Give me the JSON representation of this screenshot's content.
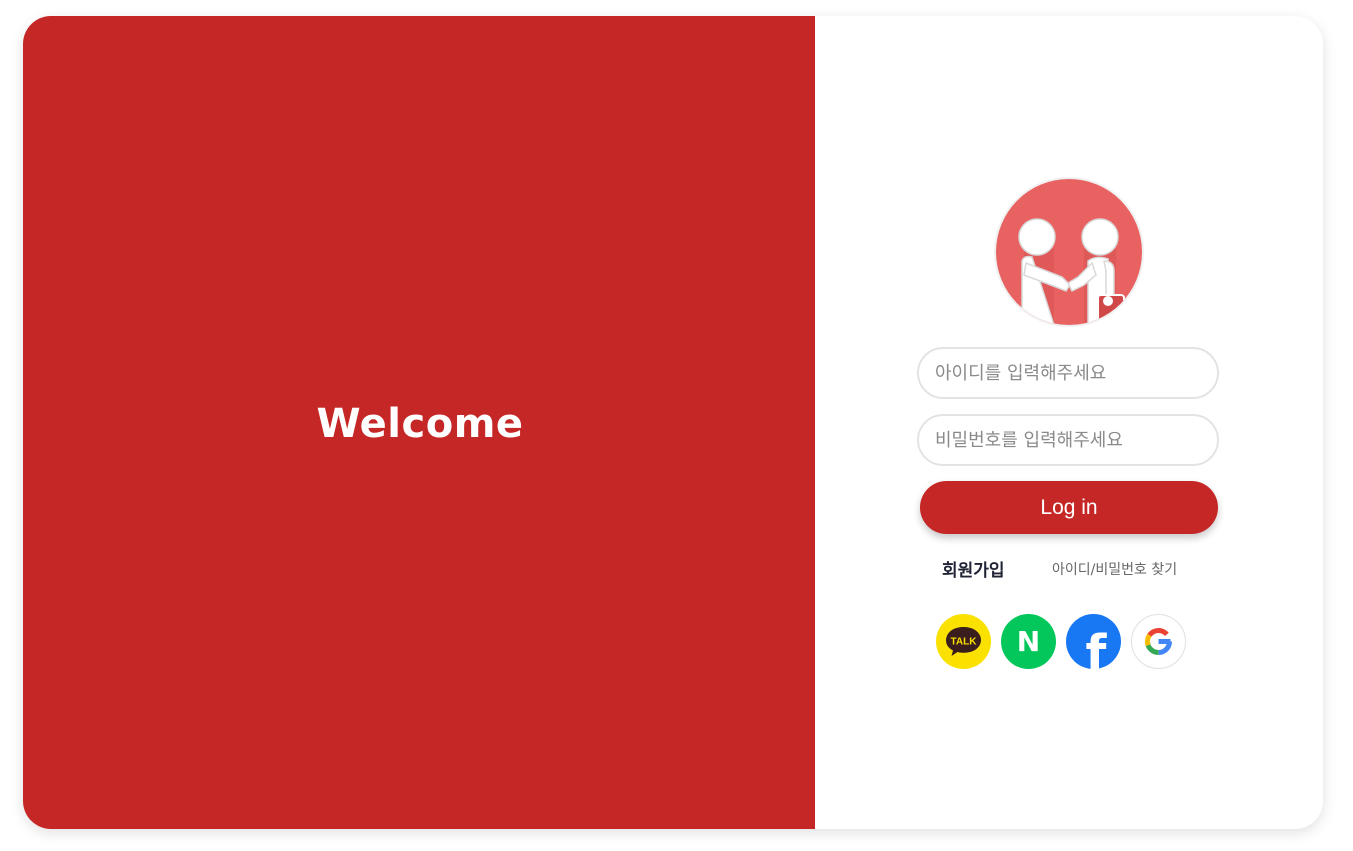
{
  "welcome_panel": {
    "heading": "Welcome"
  },
  "login_form": {
    "id_placeholder": "아이디를 입력해주세요",
    "password_placeholder": "비밀번호를 입력해주세요",
    "login_button": "Log in"
  },
  "links": {
    "signup": "회원가입",
    "find_account": "아이디/비밀번호 찾기"
  },
  "social_login": {
    "kakao_badge": "TALK",
    "naver_letter": "N",
    "facebook_letter": "f",
    "google_letter": "G",
    "icons": [
      "kakao-talk-icon",
      "naver-icon",
      "facebook-icon",
      "google-icon"
    ]
  },
  "colors": {
    "brand_red": "#c42726",
    "avatar_bg": "#e86262",
    "kakao_yellow": "#fae100",
    "naver_green": "#03c75a",
    "facebook_blue": "#1877f2"
  }
}
